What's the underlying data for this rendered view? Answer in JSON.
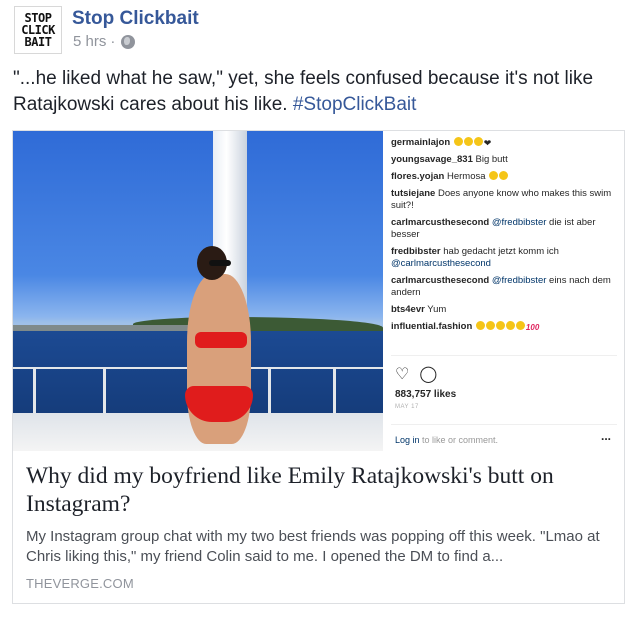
{
  "post": {
    "page_name": "Stop Clickbait",
    "avatar_lines": [
      "STOP",
      "CLICK",
      "BAIT"
    ],
    "timestamp": "5 hrs",
    "separator": "·",
    "privacy_icon": "globe-icon",
    "text": "\"...he liked what he saw,\" yet, she feels confused because it's not like Ratajkowski cares about his like.",
    "hashtag": "#StopClickBait"
  },
  "link_card": {
    "instagram": {
      "comments": [
        {
          "user": "germainlajon",
          "text": "",
          "emojis": [
            "face",
            "face",
            "face",
            "heart"
          ]
        },
        {
          "user": "youngsavage_831",
          "text": "Big butt",
          "emojis": []
        },
        {
          "user": "flores.yojan",
          "text": "Hermosa",
          "emojis": [
            "face",
            "face"
          ]
        },
        {
          "user": "tutsiejane",
          "text": "Does anyone know who makes this swim suit?!",
          "emojis": []
        },
        {
          "user": "carlmarcusthesecond",
          "mention": "@fredbibster",
          "text": "die ist aber besser",
          "emojis": []
        },
        {
          "user": "fredbibster",
          "text": "hab gedacht jetzt komm ich",
          "mention_after": "@carlmarcusthesecond",
          "emojis": []
        },
        {
          "user": "carlmarcusthesecond",
          "mention": "@fredbibster",
          "text": "eins nach dem andern",
          "emojis": []
        },
        {
          "user": "bts4evr",
          "text": "Yum",
          "emojis": []
        },
        {
          "user": "influential.fashion",
          "text": "",
          "emojis": [
            "face",
            "face",
            "face",
            "face",
            "face",
            "hundred"
          ]
        }
      ],
      "heart_icon": "heart-icon",
      "comment_icon": "comment-icon",
      "likes": "883,757 likes",
      "date": "MAY 17",
      "login_link": "Log in",
      "login_rest": " to like or comment.",
      "more": "..."
    },
    "title": "Why did my boyfriend like Emily Ratajkowski's butt on Instagram?",
    "description": "My Instagram group chat with my two best friends was popping off this week. \"Lmao at Chris liking this,\" my friend Colin said to me. I opened the DM to find a...",
    "domain": "THEVERGE.COM"
  },
  "colors": {
    "link": "#365899",
    "meta": "#90949c",
    "text": "#1d2129",
    "border": "#dddfe2"
  }
}
